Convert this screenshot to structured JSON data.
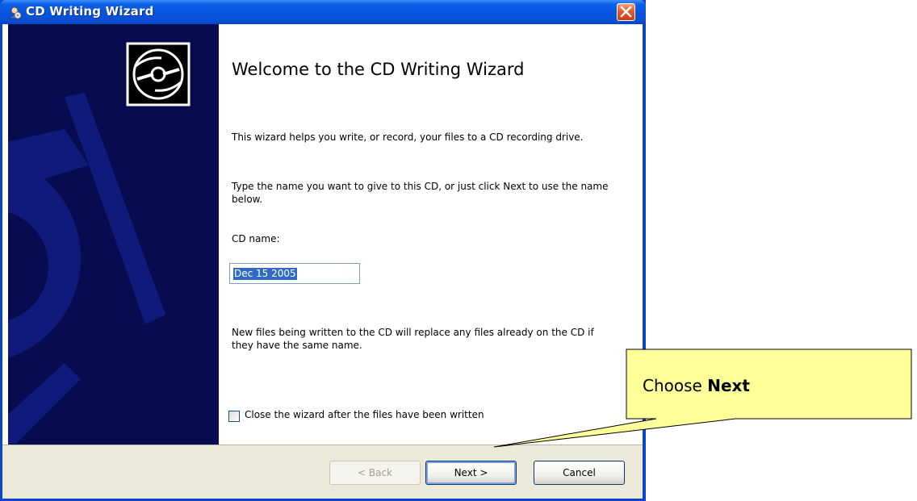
{
  "window": {
    "title": "CD Writing Wizard",
    "title_icon": "cd-writer-icon",
    "close_icon": "close-icon"
  },
  "side_panel": {
    "logo_icon": "cd-disc-icon"
  },
  "main": {
    "heading": "Welcome to the CD Writing Wizard",
    "intro": "This wizard helps you write, or record, your files to a CD recording drive.",
    "instruction": "Type the name you want to give to this CD, or just click Next to use the name below.",
    "cd_name_label": "CD name:",
    "cd_name_value": "Dec 15 2005",
    "note": "New files being written to the CD will replace any files already on the CD if they have the same name.",
    "close_checkbox_label": "Close the wizard after the files have been written",
    "close_checkbox_checked": false
  },
  "buttons": {
    "back": "< Back",
    "next": "Next >",
    "cancel": "Cancel"
  },
  "callout": {
    "prefix": "Choose",
    "emphasis": "Next",
    "fill": "#ffff99"
  },
  "colors": {
    "titlebar": "#0a59d6",
    "side_panel": "#070b4f",
    "footer": "#ece9d8",
    "selection": "#316ac5"
  }
}
